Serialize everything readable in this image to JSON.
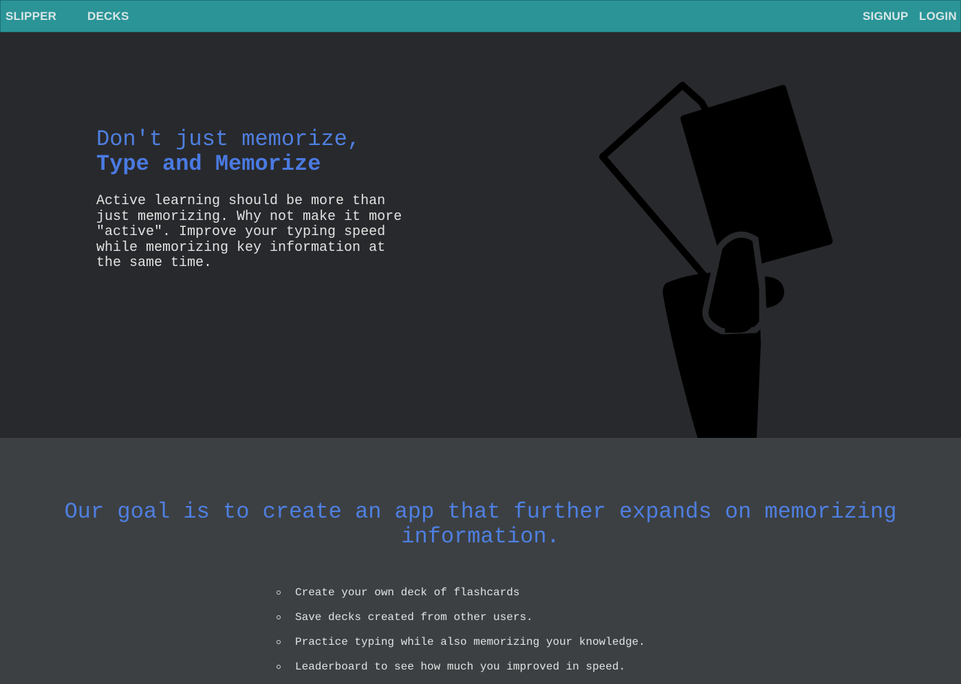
{
  "nav": {
    "brand": "SLIPPER",
    "decks": "DECKS",
    "signup": "SIGNUP",
    "login": "LOGIN"
  },
  "hero": {
    "title_line1": "Don't just memorize,",
    "title_line2": "Type and Memorize",
    "body": "Active learning should be more than just memorizing. Why not make it more \"active\". Improve your typing speed while memorizing key information at the same time.",
    "illustration_icon": "hand-holding-flashcards-icon"
  },
  "goal": {
    "heading": "Our goal is to create an app that further expands on memorizing information.",
    "features": [
      "Create your own deck of flashcards",
      "Save decks created from other users.",
      "Practice typing while also memorizing your knowledge.",
      "Leaderboard to see how much you improved in speed."
    ]
  },
  "colors": {
    "navbar": "#2a9497",
    "hero_bg": "#28292c",
    "goal_bg": "#3c4043",
    "accent_blue": "#4f7fe0",
    "body_text": "#e2e2e2"
  }
}
